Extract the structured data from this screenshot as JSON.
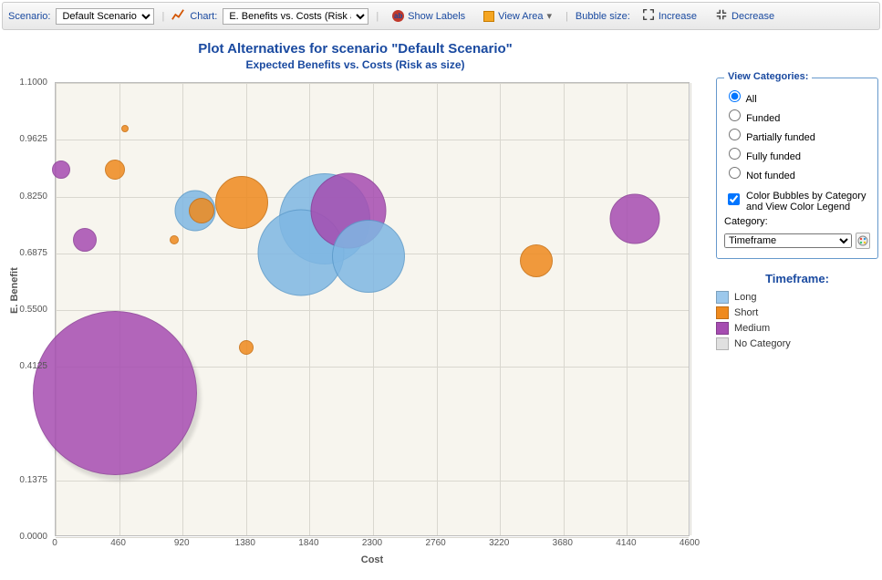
{
  "toolbar": {
    "scenario_label": "Scenario:",
    "scenario_value": "Default Scenario",
    "chart_label": "Chart:",
    "chart_value": "E. Benefits vs. Costs (Risk as size)",
    "show_labels": "Show Labels",
    "view_area": "View Area",
    "bubble_size_label": "Bubble size:",
    "increase": "Increase",
    "decrease": "Decrease"
  },
  "chart": {
    "title": "Plot Alternatives for scenario \"Default Scenario\"",
    "subtitle": "Expected Benefits vs. Costs (Risk as size)",
    "xlabel": "Cost",
    "ylabel": "E. Benefit"
  },
  "sidebar": {
    "view_categories_title": "View Categories:",
    "options": [
      "All",
      "Funded",
      "Partially funded",
      "Fully funded",
      "Not funded"
    ],
    "selected": "All",
    "color_checkbox": "Color Bubbles by Category and View Color Legend",
    "category_label": "Category:",
    "category_value": "Timeframe",
    "legend_title": "Timeframe:",
    "legend_items": [
      {
        "key": "long",
        "label": "Long"
      },
      {
        "key": "short",
        "label": "Short"
      },
      {
        "key": "medium",
        "label": "Medium"
      },
      {
        "key": "none",
        "label": "No Category"
      }
    ]
  },
  "chart_data": {
    "type": "scatter",
    "title": "Plot Alternatives for scenario \"Default Scenario\"",
    "subtitle": "Expected Benefits vs. Costs (Risk as size)",
    "xlabel": "Cost",
    "ylabel": "E. Benefit",
    "xlim": [
      0,
      4600
    ],
    "ylim": [
      0.0,
      1.1
    ],
    "xticks": [
      0,
      460,
      920,
      1380,
      1840,
      2300,
      2760,
      3220,
      3680,
      4140,
      4600
    ],
    "yticks": [
      0.0,
      0.1375,
      0.4125,
      0.55,
      0.6875,
      0.825,
      0.9625,
      1.1
    ],
    "size_encodes": "Risk",
    "color_encodes": "Timeframe",
    "series": [
      {
        "name": "Long",
        "color": "#7fb7e3",
        "points": [
          {
            "x": 1010,
            "y": 0.79,
            "r": 45
          },
          {
            "x": 1780,
            "y": 0.69,
            "r": 95
          },
          {
            "x": 1950,
            "y": 0.77,
            "r": 100
          },
          {
            "x": 2270,
            "y": 0.68,
            "r": 80
          }
        ]
      },
      {
        "name": "Short",
        "color": "#ef8a1e",
        "points": [
          {
            "x": 500,
            "y": 0.99,
            "r": 8
          },
          {
            "x": 430,
            "y": 0.89,
            "r": 22
          },
          {
            "x": 860,
            "y": 0.72,
            "r": 10
          },
          {
            "x": 1060,
            "y": 0.79,
            "r": 28
          },
          {
            "x": 1350,
            "y": 0.81,
            "r": 58
          },
          {
            "x": 1380,
            "y": 0.46,
            "r": 16
          },
          {
            "x": 3480,
            "y": 0.67,
            "r": 36
          }
        ]
      },
      {
        "name": "Medium",
        "color": "#a64db1",
        "points": [
          {
            "x": 40,
            "y": 0.89,
            "r": 20
          },
          {
            "x": 210,
            "y": 0.72,
            "r": 26
          },
          {
            "x": 430,
            "y": 0.35,
            "r": 180
          },
          {
            "x": 2120,
            "y": 0.79,
            "r": 83
          },
          {
            "x": 4200,
            "y": 0.77,
            "r": 55
          }
        ]
      }
    ]
  }
}
